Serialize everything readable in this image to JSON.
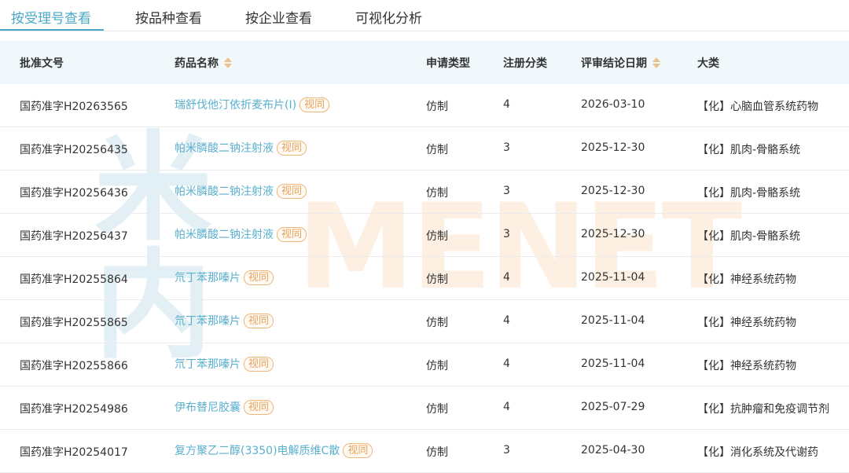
{
  "tabs": [
    {
      "label": "按受理号查看",
      "active": true
    },
    {
      "label": "按品种查看",
      "active": false
    },
    {
      "label": "按企业查看",
      "active": false
    },
    {
      "label": "可视化分析",
      "active": false
    }
  ],
  "headers": {
    "approval_no": "批准文号",
    "drug_name": "药品名称",
    "apply_type": "申请类型",
    "reg_class": "注册分类",
    "review_date": "评审结论日期",
    "category": "大类"
  },
  "watermark": {
    "cn": "米内",
    "en": "MENET"
  },
  "colors": {
    "accent": "#4aa8c9",
    "link": "#5ab0cf",
    "badge": "#e8a25a",
    "header_bg": "#f0f8fb"
  },
  "rows": [
    {
      "approval_no": "国药准字H20263565",
      "drug_name": "瑞舒伐他汀依折麦布片(Ⅰ)",
      "badge": "视同",
      "apply_type": "仿制",
      "reg_class": "4",
      "review_date": "2026-03-10",
      "category": "【化】心脑血管系统药物"
    },
    {
      "approval_no": "国药准字H20256435",
      "drug_name": "帕米膦酸二钠注射液",
      "badge": "视同",
      "apply_type": "仿制",
      "reg_class": "3",
      "review_date": "2025-12-30",
      "category": "【化】肌肉-骨骼系统"
    },
    {
      "approval_no": "国药准字H20256436",
      "drug_name": "帕米膦酸二钠注射液",
      "badge": "视同",
      "apply_type": "仿制",
      "reg_class": "3",
      "review_date": "2025-12-30",
      "category": "【化】肌肉-骨骼系统"
    },
    {
      "approval_no": "国药准字H20256437",
      "drug_name": "帕米膦酸二钠注射液",
      "badge": "视同",
      "apply_type": "仿制",
      "reg_class": "3",
      "review_date": "2025-12-30",
      "category": "【化】肌肉-骨骼系统"
    },
    {
      "approval_no": "国药准字H20255864",
      "drug_name": "氘丁苯那嗪片",
      "badge": "视同",
      "apply_type": "仿制",
      "reg_class": "4",
      "review_date": "2025-11-04",
      "category": "【化】神经系统药物"
    },
    {
      "approval_no": "国药准字H20255865",
      "drug_name": "氘丁苯那嗪片",
      "badge": "视同",
      "apply_type": "仿制",
      "reg_class": "4",
      "review_date": "2025-11-04",
      "category": "【化】神经系统药物"
    },
    {
      "approval_no": "国药准字H20255866",
      "drug_name": "氘丁苯那嗪片",
      "badge": "视同",
      "apply_type": "仿制",
      "reg_class": "4",
      "review_date": "2025-11-04",
      "category": "【化】神经系统药物"
    },
    {
      "approval_no": "国药准字H20254986",
      "drug_name": "伊布替尼胶囊",
      "badge": "视同",
      "apply_type": "仿制",
      "reg_class": "4",
      "review_date": "2025-07-29",
      "category": "【化】抗肿瘤和免疫调节剂"
    },
    {
      "approval_no": "国药准字H20254017",
      "drug_name": "复方聚乙二醇(3350)电解质维C散",
      "badge": "视同",
      "apply_type": "仿制",
      "reg_class": "3",
      "review_date": "2025-04-30",
      "category": "【化】消化系统及代谢药"
    }
  ]
}
